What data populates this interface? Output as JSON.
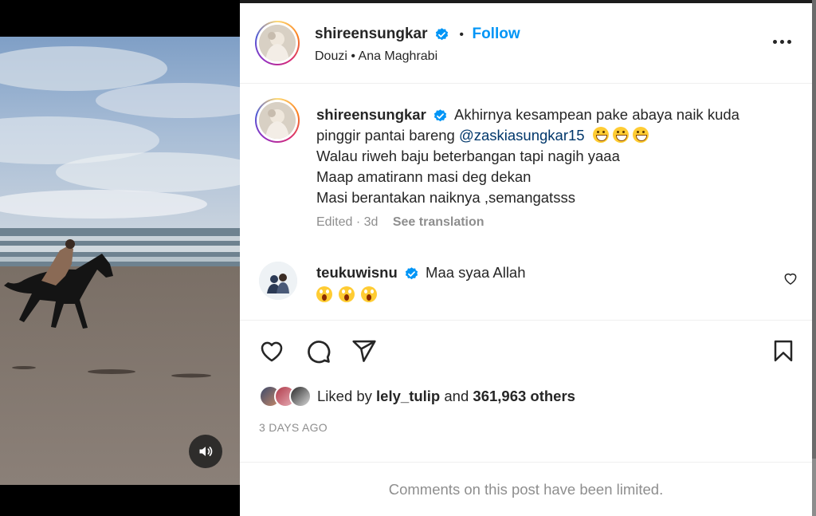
{
  "post": {
    "author": "shireensungkar",
    "follow_label": "Follow",
    "separator": "•",
    "audio": "Douzi • Ana Maghrabi"
  },
  "caption": {
    "author": "shireensungkar",
    "line1": "Akhirnya kesampean pake abaya naik kuda",
    "line2_prefix": "pinggir pantai bareng",
    "mention": "@zaskiasungkar15",
    "line3": "Walau riweh baju beterbangan tapi nagih yaaa",
    "line4": "Maap amatirann masi deg dekan",
    "line5": "Masi berantakan naiknya ,semangatsss",
    "edited": "Edited · 3d",
    "see_translation": "See translation",
    "emojis": [
      "grinning-squinting-face",
      "grinning-squinting-face",
      "grinning-squinting-face"
    ]
  },
  "comment": {
    "author": "teukuwisnu",
    "text": "Maa syaa Allah",
    "emojis": [
      "face-screaming-in-fear",
      "face-screaming-in-fear",
      "face-screaming-in-fear"
    ]
  },
  "likes": {
    "prefix": "Liked by",
    "user": "lely_tulip",
    "connector": "and",
    "others": "361,963 others"
  },
  "timestamp": "3 DAYS AGO",
  "comments_limited": "Comments on this post have been limited.",
  "colors": {
    "link_blue": "#0095f6",
    "mention": "#00376b",
    "verified": "#0095f6",
    "muted": "#8e8e8e",
    "text": "#262626"
  },
  "icons": [
    "verified-badge-icon",
    "more-options-icon",
    "heart-icon",
    "comment-icon",
    "share-icon",
    "bookmark-icon",
    "audio-icon"
  ]
}
